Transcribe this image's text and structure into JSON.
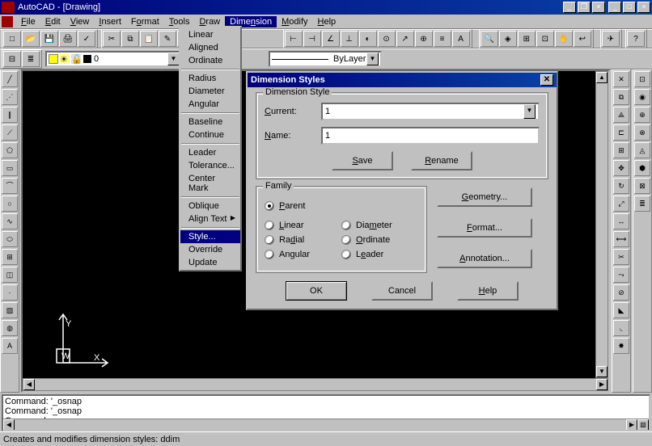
{
  "titlebar": {
    "app": "AutoCAD - [Drawing]"
  },
  "menubar": {
    "items": [
      "File",
      "Edit",
      "View",
      "Insert",
      "Format",
      "Tools",
      "Draw",
      "Dimension",
      "Modify",
      "Help"
    ],
    "active_index": 7
  },
  "dropdown": {
    "groups": [
      [
        "Linear",
        "Aligned",
        "Ordinate"
      ],
      [
        "Radius",
        "Diameter",
        "Angular"
      ],
      [
        "Baseline",
        "Continue"
      ],
      [
        "Leader",
        "Tolerance...",
        "Center Mark"
      ],
      [
        "Oblique",
        "Align Text"
      ],
      [
        "Style...",
        "Override",
        "Update"
      ]
    ],
    "submenu_items": [
      "Align Text"
    ],
    "highlighted": "Style..."
  },
  "layer_panel": {
    "layer_value": "0",
    "linetype_value": "ByLayer"
  },
  "dialog": {
    "title": "Dimension Styles",
    "style_group": "Dimension Style",
    "current_label": "Current:",
    "current_value": "1",
    "name_label": "Name:",
    "name_value": "1",
    "save": "Save",
    "rename": "Rename",
    "family_group": "Family",
    "family_options": [
      "Parent",
      "Linear",
      "Radial",
      "Angular",
      "Diameter",
      "Ordinate",
      "Leader"
    ],
    "family_selected": "Parent",
    "geometry": "Geometry...",
    "format": "Format...",
    "annotation": "Annotation...",
    "ok": "OK",
    "cancel": "Cancel",
    "help": "Help"
  },
  "command": {
    "lines": [
      "Command: '_osnap",
      "Command: '_osnap",
      "Command:"
    ]
  },
  "statusbar": {
    "text": "Creates and modifies dimension styles:  ddim"
  }
}
